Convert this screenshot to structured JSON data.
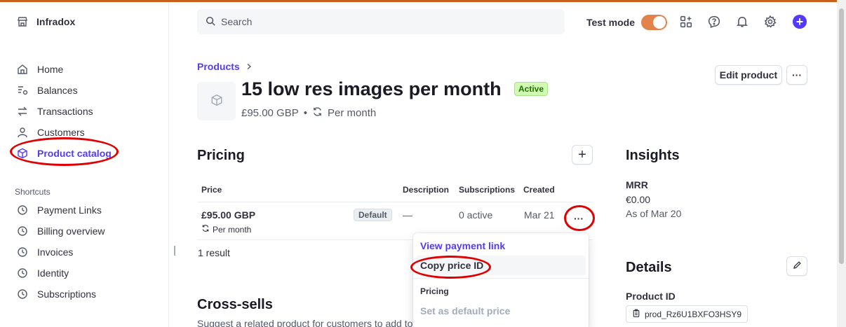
{
  "colors": {
    "accent": "#533afd",
    "test_mode": "#e4824b",
    "active_badge_bg": "#d1fab3",
    "annotation": "#e00000"
  },
  "sidebar": {
    "account_name": "Infradox",
    "items": [
      {
        "label": "Home",
        "icon": "home-icon"
      },
      {
        "label": "Balances",
        "icon": "balances-icon"
      },
      {
        "label": "Transactions",
        "icon": "transactions-icon"
      },
      {
        "label": "Customers",
        "icon": "customers-icon"
      },
      {
        "label": "Product catalog",
        "icon": "product-catalog-icon",
        "active": true
      }
    ],
    "shortcuts_label": "Shortcuts",
    "shortcuts": [
      {
        "label": "Payment Links"
      },
      {
        "label": "Billing overview"
      },
      {
        "label": "Invoices"
      },
      {
        "label": "Identity"
      },
      {
        "label": "Subscriptions"
      }
    ]
  },
  "header": {
    "search_placeholder": "Search",
    "test_mode_label": "Test mode",
    "test_mode_on": true
  },
  "product": {
    "breadcrumb": "Products",
    "name": "15 low res images per month",
    "status": "Active",
    "price": "£95.00 GBP",
    "interval": "Per month",
    "edit_label": "Edit product",
    "more_label": "···"
  },
  "pricing": {
    "title": "Pricing",
    "add_label": "+",
    "columns": [
      "Price",
      "Description",
      "Subscriptions",
      "Created"
    ],
    "rows": [
      {
        "price": "£95.00 GBP",
        "interval": "Per month",
        "badge": "Default",
        "description": "—",
        "subscriptions": "0 active",
        "created": "Mar 21",
        "more": "···"
      }
    ],
    "result_count": "1 result"
  },
  "menu": {
    "view_payment_link": "View payment link",
    "copy_price_id": "Copy price ID",
    "section_label": "Pricing",
    "set_default": "Set as default price"
  },
  "cross_sells": {
    "title": "Cross-sells",
    "description": "Suggest a related product for customers to add to"
  },
  "insights": {
    "title": "Insights",
    "mrr_label": "MRR",
    "mrr_value": "€0.00",
    "as_of": "As of Mar 20"
  },
  "details": {
    "title": "Details",
    "product_id_label": "Product ID",
    "product_id": "prod_Rz6U1BXFO3HSY9"
  }
}
